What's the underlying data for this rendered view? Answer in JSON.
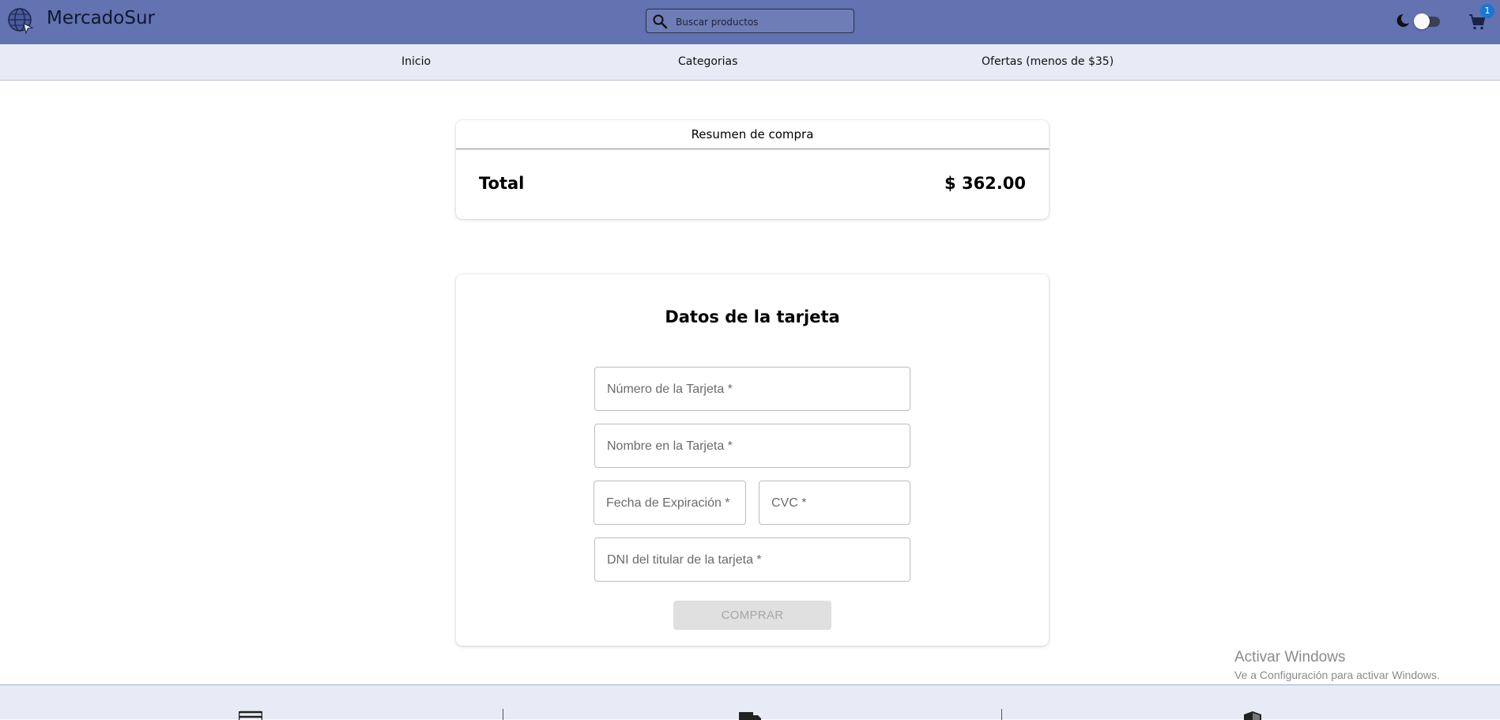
{
  "header": {
    "brand": "MercadoSur",
    "search_placeholder": "Buscar productos",
    "cart_count": "1",
    "icons": [
      "globe-logo-icon",
      "search-icon",
      "moon-icon",
      "cart-icon"
    ],
    "colors": {
      "topbar": "#6372b0",
      "navbar": "#e6ebf5",
      "badge": "#1976d2"
    }
  },
  "nav": {
    "items": [
      {
        "label": "Inicio"
      },
      {
        "label": "Categorias"
      },
      {
        "label": "Ofertas (menos de $35)"
      }
    ]
  },
  "summary": {
    "heading": "Resumen de compra",
    "total_label": "Total",
    "total_value": "$ 362.00"
  },
  "payment": {
    "title": "Datos de la tarjeta",
    "fields": {
      "card_number": "Número de la Tarjeta *",
      "card_name": "Nombre en la Tarjeta *",
      "expiry": "Fecha de Expiración *",
      "cvc": "CVC *",
      "dni": "DNI del titular de la tarjeta *"
    },
    "buy_label": "COMPRAR"
  },
  "watermark": {
    "line1": "Activar Windows",
    "line2": "Ve a Configuración para activar Windows."
  },
  "footer": {
    "icons": [
      "card-icon",
      "truck-icon",
      "shield-icon"
    ]
  }
}
